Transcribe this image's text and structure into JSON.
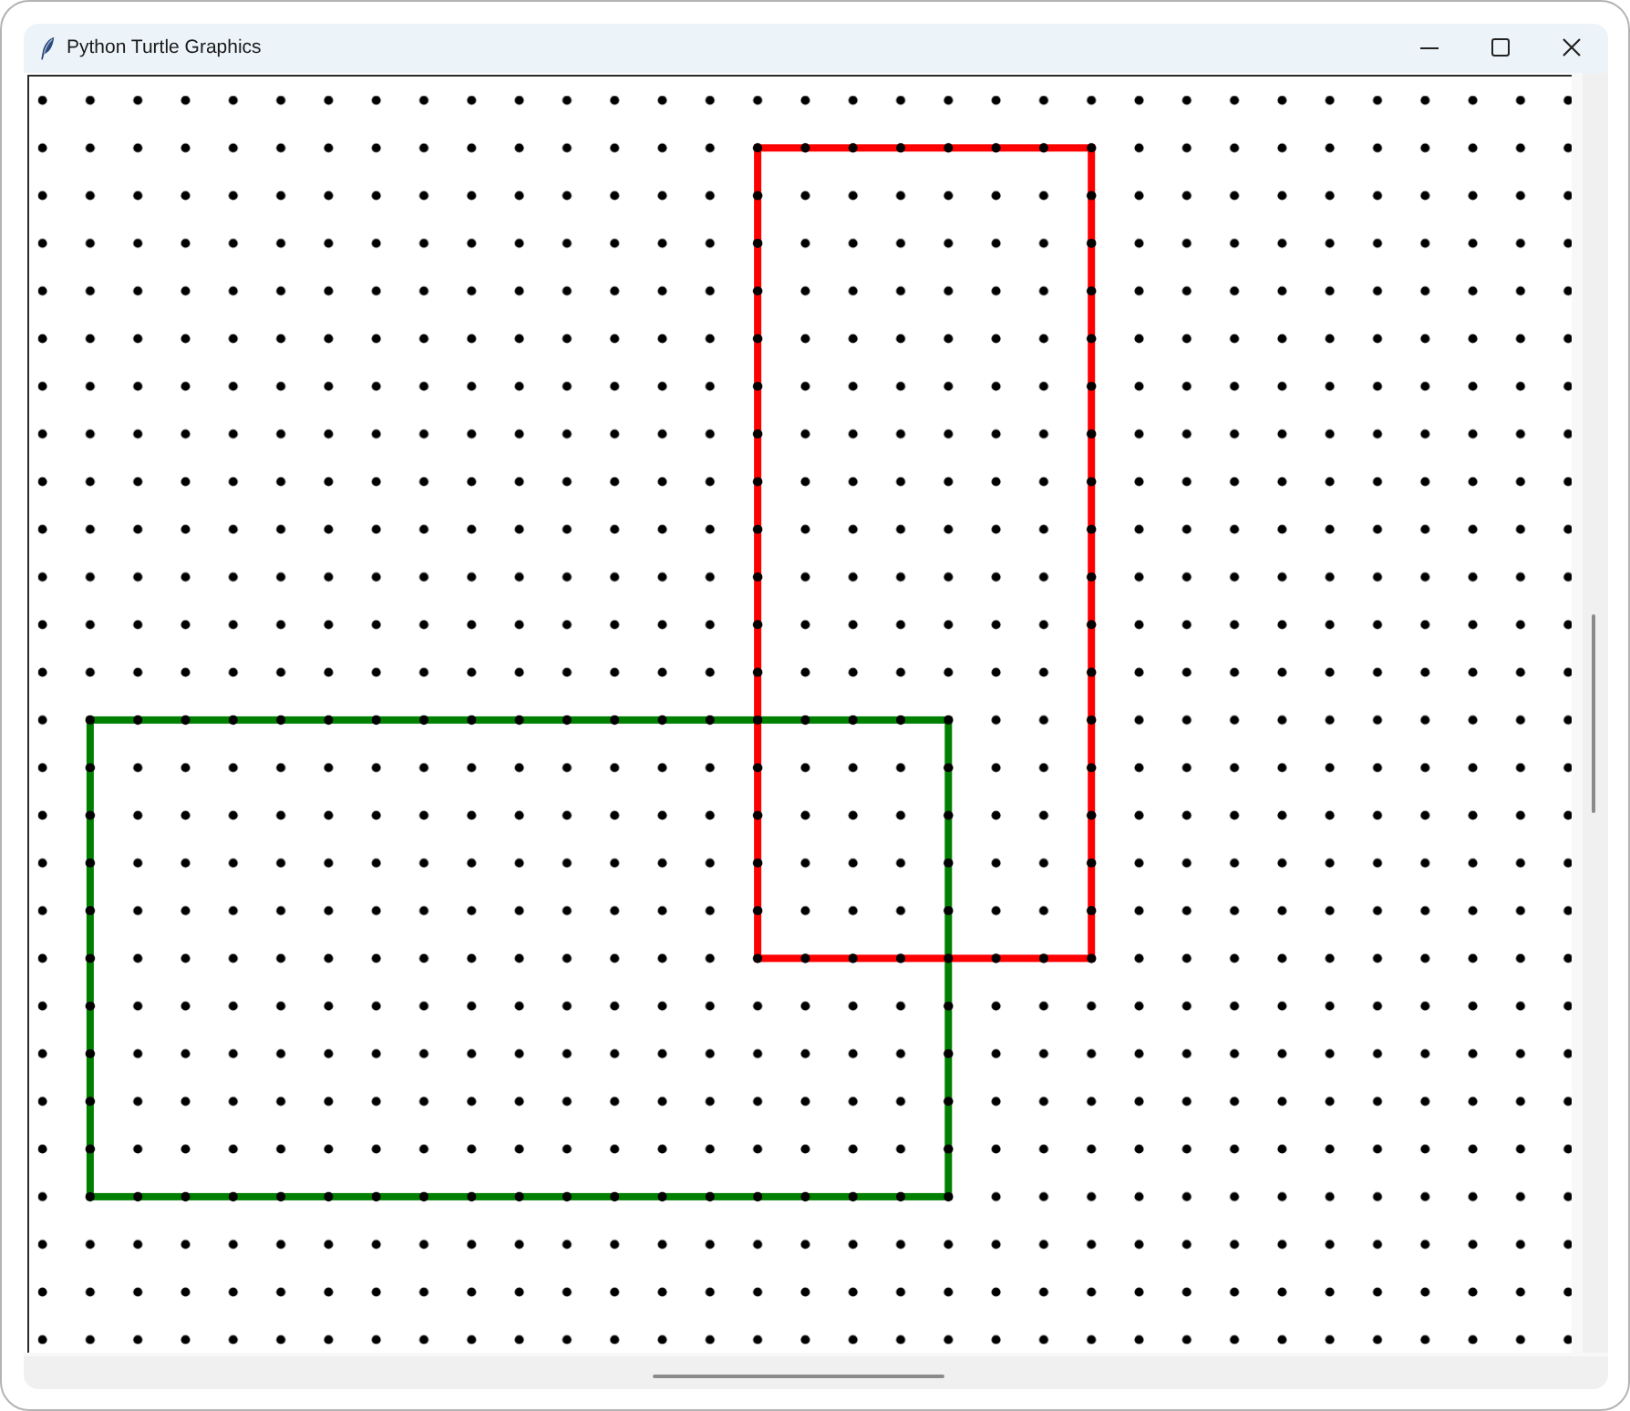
{
  "window": {
    "title": "Python Turtle Graphics"
  },
  "canvas": {
    "shapes": [
      {
        "color": "#ff0000"
      },
      {
        "color": "#008000"
      }
    ]
  }
}
